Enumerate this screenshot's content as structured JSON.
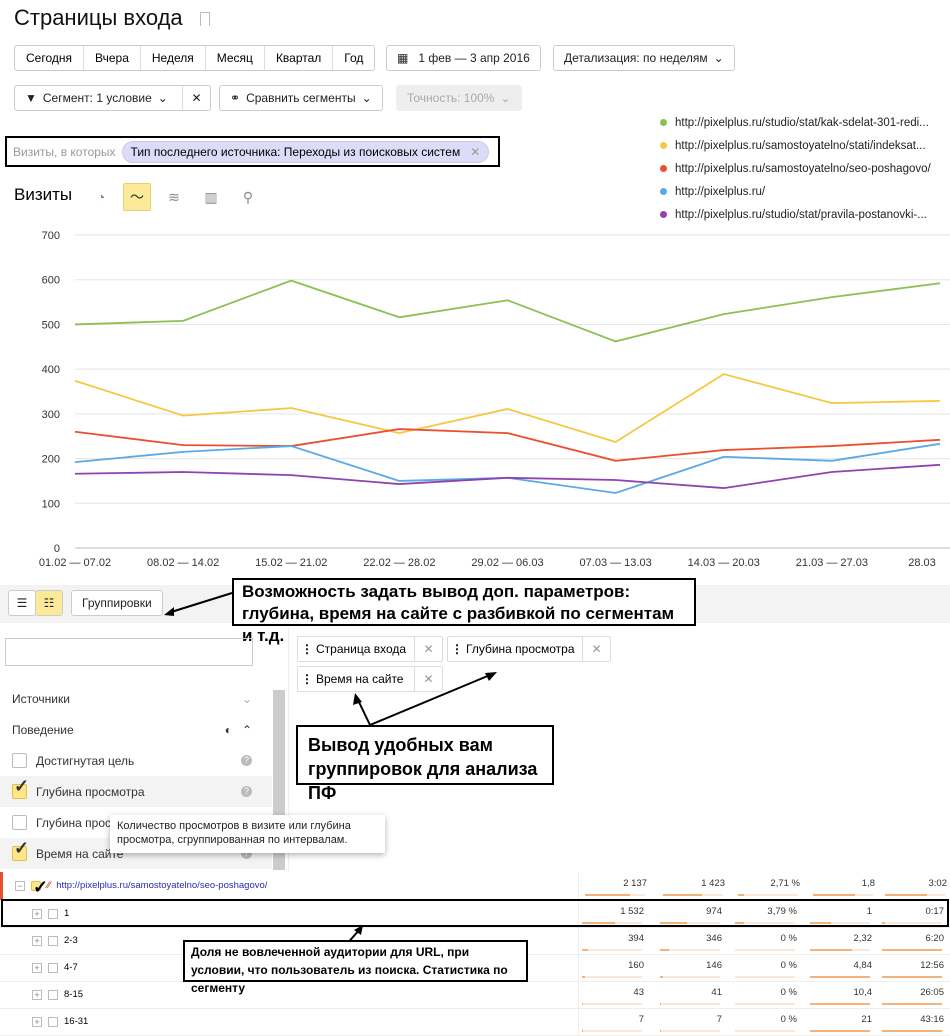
{
  "page": {
    "title": "Страницы входа"
  },
  "periods": [
    "Сегодня",
    "Вчера",
    "Неделя",
    "Месяц",
    "Квартал",
    "Год"
  ],
  "date_range": "1 фев — 3 апр 2016",
  "detail": "Детализация: по неделям",
  "segment": "Сегмент: 1 условие",
  "compare": "Сравнить сегменты",
  "accuracy": "Точность: 100%",
  "filter": {
    "prefix": "Визиты, в которых",
    "chip": "Тип последнего источника: Переходы из поисковых систем"
  },
  "metric_title": "Визиты",
  "chart_data": {
    "type": "line",
    "categories": [
      "01.02 — 07.02",
      "08.02 — 14.02",
      "15.02 — 21.02",
      "22.02 — 28.02",
      "29.02 — 06.03",
      "07.03 — 13.03",
      "14.03 — 20.03",
      "21.03 — 27.03",
      "28.03"
    ],
    "yticks": [
      "0",
      "100",
      "200",
      "300",
      "400",
      "500",
      "600",
      "700"
    ],
    "ylim": [
      0,
      700
    ],
    "grid": true,
    "legend": "top-right",
    "series": [
      {
        "name": "http://pixelplus.ru/studio/stat/kak-sdelat-301-redi...",
        "color": "#8cc152",
        "values": [
          500,
          508,
          598,
          516,
          554,
          462,
          523,
          561,
          592
        ]
      },
      {
        "name": "http://pixelplus.ru/samostoyatelno/stati/indeksat...",
        "color": "#f5c842",
        "values": [
          374,
          296,
          313,
          257,
          311,
          237,
          389,
          324,
          329
        ]
      },
      {
        "name": "http://pixelplus.ru/samostoyatelno/seo-poshagovo/",
        "color": "#e8502f",
        "values": [
          260,
          230,
          228,
          266,
          257,
          195,
          219,
          228,
          242
        ]
      },
      {
        "name": "http://pixelplus.ru/",
        "color": "#5aa9e6",
        "values": [
          192,
          215,
          228,
          150,
          157,
          123,
          204,
          195,
          233
        ]
      },
      {
        "name": "http://pixelplus.ru/studio/stat/pravila-postanovki-...",
        "color": "#8e44ad",
        "values": [
          166,
          170,
          163,
          143,
          157,
          152,
          134,
          170,
          186
        ]
      }
    ]
  },
  "groupings_button": "Группировки",
  "annotations": {
    "a1": "Возможность задать вывод доп. параметров: глубина, время на сайте с разбивкой по сегментам и т.д.",
    "a2": "Вывод удобных вам группировок для анализа ПФ",
    "a3": "Доля не вовлеченной аудитории для URL, при условии, что пользователь из поиска. Статистика по сегменту"
  },
  "tags": [
    "Страница входа",
    "Глубина просмотра",
    "Время на сайте"
  ],
  "sidebar": {
    "sections": [
      "Источники",
      "Поведение"
    ],
    "items": [
      {
        "label": "Достигнутая цель",
        "checked": false
      },
      {
        "label": "Глубина просмотра",
        "checked": true
      },
      {
        "label": "Глубина просмотра",
        "checked": false
      },
      {
        "label": "Время на сайте",
        "checked": true
      }
    ]
  },
  "tooltip": "Количество просмотров в визите или глубина просмотра, сгруппированная по интервалам.",
  "table": {
    "rows": [
      {
        "label": "http://pixelplus.ru/samostoyatelno/seo-poshagovo/",
        "cells": [
          "2 137",
          "1 423",
          "2,71 %",
          "1,8",
          "3:02"
        ],
        "bars": [
          0.75,
          0.65,
          0.1,
          0.7,
          0.7
        ]
      },
      {
        "label": "1",
        "cells": [
          "1 532",
          "974",
          "3,79 %",
          "1",
          "0:17"
        ],
        "bars": [
          0.55,
          0.45,
          0.15,
          0.35,
          0.05
        ]
      },
      {
        "label": "2-3",
        "cells": [
          "394",
          "346",
          "0 %",
          "2,32",
          "6:20"
        ],
        "bars": [
          0.1,
          0.15,
          0,
          0.7,
          1
        ]
      },
      {
        "label": "4-7",
        "cells": [
          "160",
          "146",
          "0 %",
          "4,84",
          "12:56"
        ],
        "bars": [
          0.05,
          0.05,
          0,
          1,
          1
        ]
      },
      {
        "label": "8-15",
        "cells": [
          "43",
          "41",
          "0 %",
          "10,4",
          "26:05"
        ],
        "bars": [
          0.02,
          0.02,
          0,
          1,
          1
        ]
      },
      {
        "label": "16-31",
        "cells": [
          "7",
          "7",
          "0 %",
          "21",
          "43:16"
        ],
        "bars": [
          0.01,
          0.01,
          0,
          1,
          1
        ]
      }
    ]
  }
}
